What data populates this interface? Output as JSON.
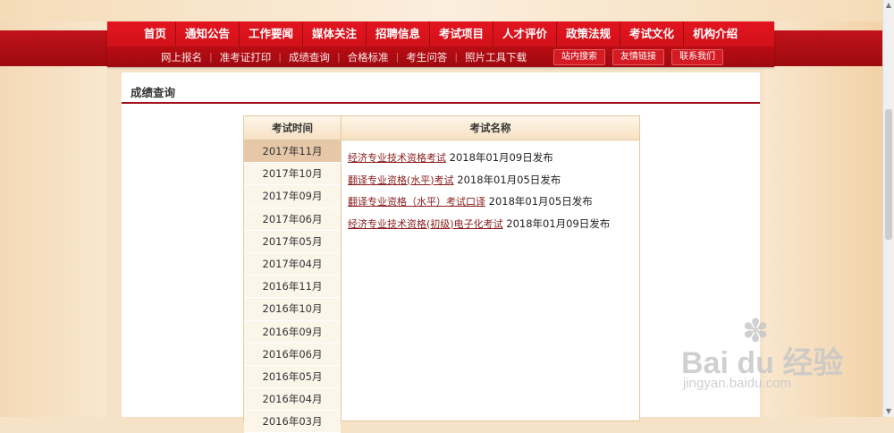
{
  "main_nav": [
    "首页",
    "通知公告",
    "工作要闻",
    "媒体关注",
    "招聘信息",
    "考试项目",
    "人才评价",
    "政策法规",
    "考试文化",
    "机构介绍"
  ],
  "sub_nav": [
    "网上报名",
    "准考证打印",
    "成绩查询",
    "合格标准",
    "考生问答",
    "照片工具下载"
  ],
  "sub_buttons": [
    "站内搜索",
    "友情链接",
    "联系我们"
  ],
  "section_title": "成绩查询",
  "table": {
    "col_time": "考试时间",
    "col_name": "考试名称",
    "dates": [
      "2017年11月",
      "2017年10月",
      "2017年09月",
      "2017年06月",
      "2017年05月",
      "2017年04月",
      "2016年11月",
      "2016年10月",
      "2016年09月",
      "2016年06月",
      "2016年05月",
      "2016年04月",
      "2016年03月"
    ],
    "exams": [
      {
        "name": "经济专业技术资格考试",
        "date": "2018年01月09日发布"
      },
      {
        "name": "翻译专业资格(水平)考试",
        "date": "2018年01月05日发布"
      },
      {
        "name": "翻译专业资格（水平）考试口译",
        "date": "2018年01月05日发布"
      },
      {
        "name": "经济专业技术资格(初级)电子化考试",
        "date": "2018年01月09日发布"
      }
    ]
  },
  "watermark": {
    "main": "Bai du 经验",
    "sub": "jingyan.baidu.com"
  },
  "icons": {
    "watermark": "paw-icon",
    "scroll_up": "arrow-up-icon",
    "scroll_down": "arrow-down-icon"
  },
  "colors": {
    "brand_red": "#d0121a",
    "accent_beige": "#f6e1c3",
    "link": "#8a1c1c"
  }
}
